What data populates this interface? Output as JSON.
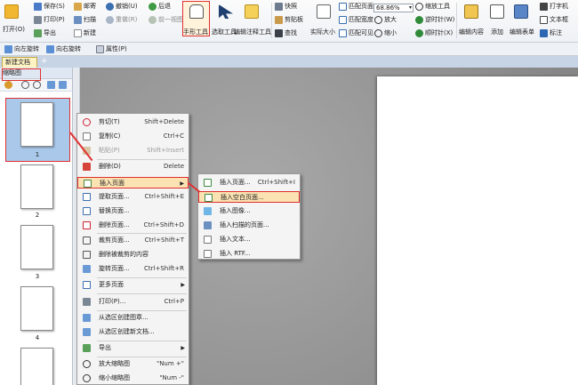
{
  "ribbon": {
    "open": "打开(O)",
    "save": "保存(S)",
    "print": "打印(P)",
    "export": "导出",
    "mail": "邮寄",
    "scan": "扫描",
    "new": "新建",
    "undo": "撤销(U)",
    "redo": "重做(R)",
    "back": "后退",
    "forward": "前一视图",
    "hand_tool": "手形工具",
    "select_tool": "选取工具",
    "edit_annot_tool": "编辑注释工具",
    "snapshot": "快照",
    "clipboard": "剪贴板",
    "find": "查找",
    "actual_size": "实际大小",
    "fit_page": "匹配页面",
    "fit_width": "匹配宽度",
    "fit_visible": "匹配可见",
    "zoom_value": "68.86%",
    "zoom_in": "放大",
    "zoom_out": "缩小",
    "zoom_tool": "缩放工具",
    "rotate_ccw": "逆时针(W)",
    "rotate_cw": "顺时针(X)",
    "edit_content": "编辑内容",
    "add": "添加",
    "edit_form": "编辑表单",
    "typewriter": "打字机",
    "textbox": "文本框",
    "mark": "标注"
  },
  "toolbar2": {
    "rotate_left": "向左旋转",
    "rotate_right": "向右旋转",
    "properties": "属性(P)"
  },
  "tab": {
    "name": "新建文档",
    "add": "+"
  },
  "thumbnail_panel": {
    "title": "缩略图",
    "pages": [
      "1",
      "2",
      "3",
      "4"
    ]
  },
  "context_menu": {
    "items": [
      {
        "label": "剪切(T)",
        "shortcut": "Shift+Delete"
      },
      {
        "label": "复制(C)",
        "shortcut": "Ctrl+C"
      },
      {
        "label": "粘贴(P)",
        "shortcut": "Shift+Insert"
      },
      {
        "label": "删除(D)",
        "shortcut": "Delete"
      },
      {
        "label": "插入页面",
        "shortcut": ""
      },
      {
        "label": "提取页面...",
        "shortcut": "Ctrl+Shift+E"
      },
      {
        "label": "替换页面...",
        "shortcut": ""
      },
      {
        "label": "删除页面...",
        "shortcut": "Ctrl+Shift+D"
      },
      {
        "label": "裁剪页面...",
        "shortcut": "Ctrl+Shift+T"
      },
      {
        "label": "删除被裁剪的内容",
        "shortcut": ""
      },
      {
        "label": "旋转页面...",
        "shortcut": "Ctrl+Shift+R"
      },
      {
        "label": "更多页面",
        "shortcut": ""
      },
      {
        "label": "打印(P)...",
        "shortcut": "Ctrl+P"
      },
      {
        "label": "从选区创建图章...",
        "shortcut": ""
      },
      {
        "label": "从选区创建新文档...",
        "shortcut": ""
      },
      {
        "label": "导出",
        "shortcut": ""
      },
      {
        "label": "放大缩略图",
        "shortcut": "\"Num +\""
      },
      {
        "label": "缩小缩略图",
        "shortcut": "\"Num -\""
      }
    ]
  },
  "submenu": {
    "items": [
      {
        "label": "插入页面...",
        "shortcut": "Ctrl+Shift+I"
      },
      {
        "label": "插入空白页面...",
        "shortcut": ""
      },
      {
        "label": "插入图像...",
        "shortcut": ""
      },
      {
        "label": "插入扫描的页面...",
        "shortcut": ""
      },
      {
        "label": "插入文本...",
        "shortcut": ""
      },
      {
        "label": "插入 RTF...",
        "shortcut": ""
      }
    ]
  },
  "colors": {
    "highlight_border": "#e03030",
    "selection": "#a9c8ea",
    "menu_hover": "#fbe2b2"
  }
}
